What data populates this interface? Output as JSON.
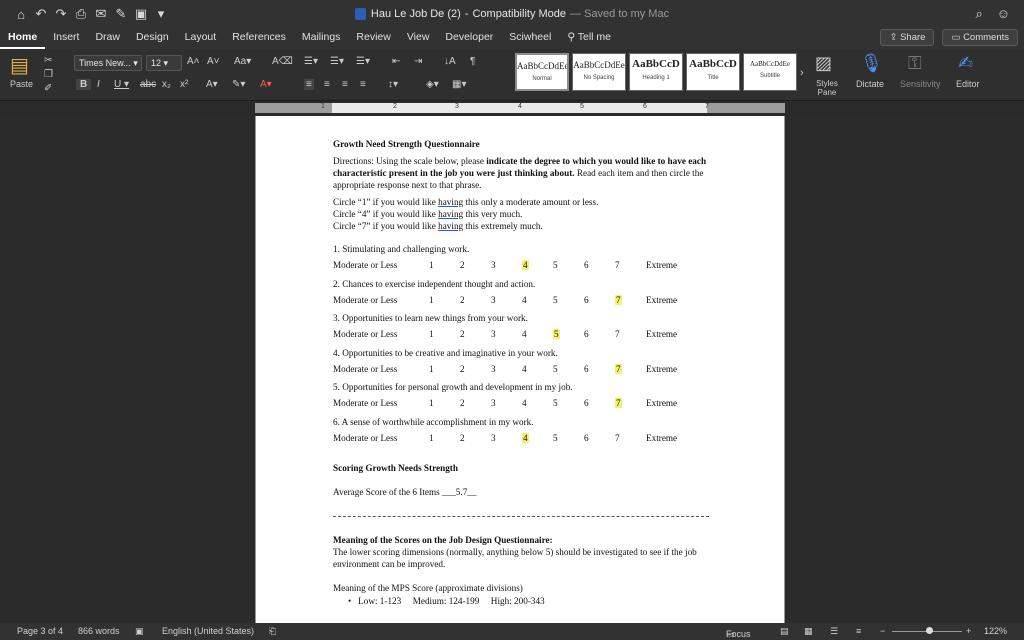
{
  "window": {
    "title": "Hau Le Job De (2)",
    "mode": "Compatibility Mode",
    "saved": "— Saved to my Mac"
  },
  "tabs": [
    "Home",
    "Insert",
    "Draw",
    "Design",
    "Layout",
    "References",
    "Mailings",
    "Review",
    "View",
    "Developer",
    "Sciwheel",
    "Tell me"
  ],
  "actions": {
    "share": "Share",
    "comments": "Comments"
  },
  "ribbon": {
    "paste": "Paste",
    "font_name": "Times New...",
    "font_size": "12",
    "styles": [
      {
        "preview": "AaBbCcDdEe",
        "name": "Normal"
      },
      {
        "preview": "AaBbCcDdEe",
        "name": "No Spacing"
      },
      {
        "preview": "AaBbCcD",
        "name": "Heading 1"
      },
      {
        "preview": "AaBbCcD",
        "name": "Title"
      },
      {
        "preview": "AaBbCcDdEe",
        "name": "Subtitle"
      }
    ],
    "styles_pane": "Styles Pane",
    "dictate": "Dictate",
    "sensitivity": "Sensitivity",
    "editor": "Editor"
  },
  "ruler_numbers": [
    "1",
    "2",
    "3",
    "4",
    "5",
    "6",
    "7"
  ],
  "document": {
    "heading": "Growth Need Strength Questionnaire",
    "directions_pre": "Directions: Using the scale below, please ",
    "directions_bold": "indicate the degree to which you would like to have each characteristic present in the job you were just thinking about.",
    "directions_post": " Read each item and then circle the appropriate response next to that phrase.",
    "circle_lines": [
      {
        "pre": "Circle “1” if you would like ",
        "word": "having",
        "post": " this only a moderate amount or less."
      },
      {
        "pre": "Circle “4” if you would like ",
        "word": "having",
        "post": " this very much."
      },
      {
        "pre": "Circle “7” if you would like ",
        "word": "having",
        "post": " this extremely much."
      }
    ],
    "scale_low": "Moderate or Less",
    "scale_high": "Extreme",
    "scale_numbers": [
      "1",
      "2",
      "3",
      "4",
      "5",
      "6",
      "7"
    ],
    "items": [
      {
        "text": "1. Stimulating and challenging work.",
        "selected": 4
      },
      {
        "text": "2. Chances to exercise independent thought and action.",
        "selected": 7
      },
      {
        "text": "3. Opportunities to learn new things from your work.",
        "selected": 5
      },
      {
        "text": "4. Opportunities to be creative and imaginative in your work.",
        "selected": 7
      },
      {
        "text": "5. Opportunities for personal growth and development in my job.",
        "selected": 7
      },
      {
        "text": "6. A sense of worthwhile accomplishment in my work.",
        "selected": 4
      }
    ],
    "scoring_heading": "Scoring Growth Needs Strength",
    "average_label": "Average Score of the 6 Items",
    "average_value": "5.7",
    "meaning_heading": "Meaning of the Scores on the Job Design Questionnaire:",
    "meaning_text": "The lower scoring dimensions (normally, anything below 5) should be investigated to see if the job environment can be improved.",
    "mps_heading": "Meaning of the MPS Score (approximate divisions)",
    "mps_bullet": "Low: 1-123     Medium: 124-199     High: 200-343"
  },
  "status": {
    "page": "Page 3 of 4",
    "words": "866 words",
    "language": "English (United States)",
    "focus": "Focus",
    "zoom": "122%"
  }
}
